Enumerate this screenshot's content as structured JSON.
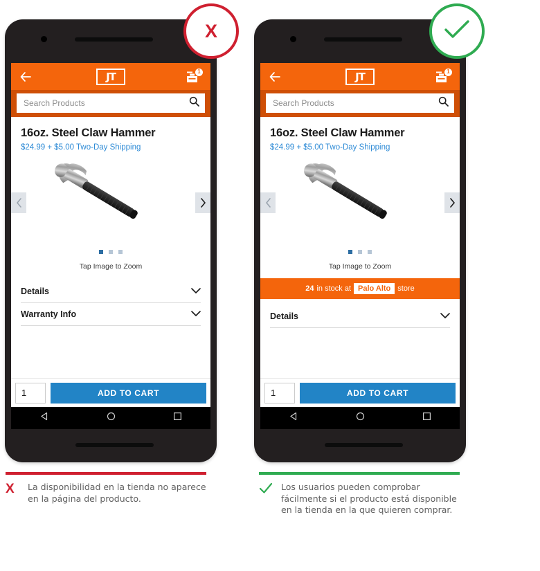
{
  "comparison": {
    "bad": {
      "badge_icon": "x-mark-icon",
      "badge_symbol": "X",
      "accent_color": "#cf2030",
      "caption_mark": "X",
      "caption_text": "La disponibilidad en la tienda no aparece en la página del producto."
    },
    "good": {
      "badge_icon": "check-mark-icon",
      "accent_color": "#2fab51",
      "caption_mark": "check-mark-icon",
      "caption_text": "Los usuarios pueden comprobar fácilmente si el producto está disponible en la tienda en la que quieren comprar."
    }
  },
  "app": {
    "brand_color": "#f4650c",
    "search_strip_color": "#cf4f06",
    "link_color": "#2e8bd6",
    "button_color": "#2284c6",
    "appbar": {
      "back_icon": "back-arrow-icon",
      "logo_text": "JT",
      "cart_icon": "toolbox-cart-icon",
      "cart_badge_count": "1"
    },
    "search": {
      "placeholder": "Search Products",
      "value": "",
      "icon": "search-icon"
    },
    "product": {
      "title": "16oz. Steel Claw Hammer",
      "price_line": "$24.99 + $5.00 Two-Day Shipping",
      "image_alt": "steel-claw-hammer-photo",
      "prev_icon": "chevron-left-icon",
      "next_icon": "chevron-right-icon",
      "dots_total": 3,
      "dots_active_index": 0,
      "zoom_hint": "Tap Image to Zoom"
    },
    "stock_banner": {
      "quantity": "24",
      "text_before": "in stock at",
      "store_name": "Palo Alto",
      "text_after": "store"
    },
    "accordions": [
      {
        "label": "Details",
        "icon": "chevron-down-icon"
      },
      {
        "label": "Warranty Info",
        "icon": "chevron-down-icon"
      }
    ],
    "action_bar": {
      "quantity_value": "1",
      "add_to_cart_label": "ADD TO CART"
    },
    "android_nav": {
      "back_icon": "android-back-triangle-icon",
      "home_icon": "android-home-circle-icon",
      "recents_icon": "android-recents-square-icon"
    }
  }
}
